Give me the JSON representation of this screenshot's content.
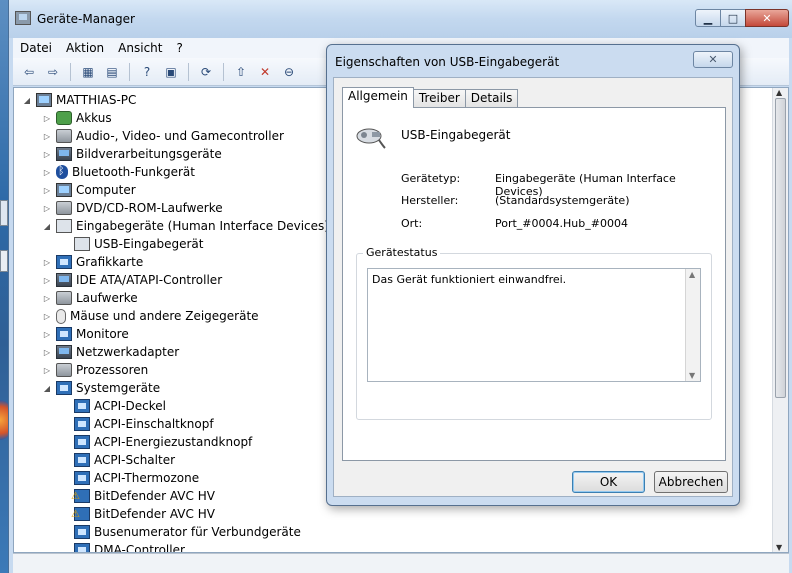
{
  "main_window": {
    "title": "Geräte-Manager",
    "caption_buttons": {
      "minimize": "▁",
      "maximize": "□",
      "close": "✕"
    },
    "menu": [
      "Datei",
      "Aktion",
      "Ansicht",
      "?"
    ],
    "toolbar_icons": [
      "back-icon",
      "forward-icon",
      "properties-icon",
      "view-icon",
      "help-icon",
      "show-hidden-icon",
      "scan-hardware-icon",
      "update-driver-icon",
      "disable-device-icon",
      "uninstall-icon"
    ],
    "toolbar_glyphs": [
      "⇦",
      "⇨",
      "▦",
      "▤",
      "?",
      "▣",
      "⟳",
      "⇧",
      "✕",
      "⊖"
    ],
    "tree": [
      {
        "label": "MATTHIAS-PC",
        "arrow": "◢",
        "icon": "pc"
      },
      {
        "label": "Akkus",
        "arrow": "▷",
        "icon": "green"
      },
      {
        "label": "Audio-, Video- und Gamecontroller",
        "arrow": "▷",
        "icon": "gray"
      },
      {
        "label": "Bildverarbeitungsgeräte",
        "arrow": "▷",
        "icon": "device"
      },
      {
        "label": "Bluetooth-Funkgerät",
        "arrow": "▷",
        "icon": "bt"
      },
      {
        "label": "Computer",
        "arrow": "▷",
        "icon": "pc"
      },
      {
        "label": "DVD/CD-ROM-Laufwerke",
        "arrow": "▷",
        "icon": "gray"
      },
      {
        "label": "Eingabegeräte (Human Interface Devices)",
        "arrow": "◢",
        "icon": "usb"
      },
      {
        "label": "USB-Eingabegerät",
        "arrow": "",
        "icon": "usb"
      },
      {
        "label": "Grafikkarte",
        "arrow": "▷",
        "icon": "sys"
      },
      {
        "label": "IDE ATA/ATAPI-Controller",
        "arrow": "▷",
        "icon": "device"
      },
      {
        "label": "Laufwerke",
        "arrow": "▷",
        "icon": "gray"
      },
      {
        "label": "Mäuse und andere Zeigegeräte",
        "arrow": "▷",
        "icon": "mouse"
      },
      {
        "label": "Monitore",
        "arrow": "▷",
        "icon": "sys"
      },
      {
        "label": "Netzwerkadapter",
        "arrow": "▷",
        "icon": "device"
      },
      {
        "label": "Prozessoren",
        "arrow": "▷",
        "icon": "gray"
      },
      {
        "label": "Systemgeräte",
        "arrow": "◢",
        "icon": "sys"
      },
      {
        "label": "ACPI-Deckel",
        "arrow": "",
        "icon": "sys"
      },
      {
        "label": "ACPI-Einschaltknopf",
        "arrow": "",
        "icon": "sys"
      },
      {
        "label": "ACPI-Energiezustandknopf",
        "arrow": "",
        "icon": "sys"
      },
      {
        "label": "ACPI-Schalter",
        "arrow": "",
        "icon": "sys"
      },
      {
        "label": "ACPI-Thermozone",
        "arrow": "",
        "icon": "sys"
      },
      {
        "label": "BitDefender AVC HV",
        "arrow": "",
        "icon": "warn"
      },
      {
        "label": "BitDefender AVC HV",
        "arrow": "",
        "icon": "warn"
      },
      {
        "label": "Busenumerator für Verbundgeräte",
        "arrow": "",
        "icon": "sys"
      },
      {
        "label": "DMA-Controller",
        "arrow": "",
        "icon": "sys"
      }
    ]
  },
  "dialog": {
    "title": "Eigenschaften von USB-Eingabegerät",
    "close_glyph": "✕",
    "tabs": [
      "Allgemein",
      "Treiber",
      "Details"
    ],
    "active_tab": "Allgemein",
    "device_name": "USB-Eingabegerät",
    "properties": [
      {
        "label": "Gerätetyp:",
        "value": "Eingabegeräte (Human Interface Devices)"
      },
      {
        "label": "Hersteller:",
        "value": "(Standardsystemgeräte)"
      },
      {
        "label": "Ort:",
        "value": "Port_#0004.Hub_#0004"
      }
    ],
    "status_group_label": "Gerätestatus",
    "status_text": "Das Gerät funktioniert einwandfrei.",
    "ok_label": "OK",
    "cancel_label": "Abbrechen"
  }
}
